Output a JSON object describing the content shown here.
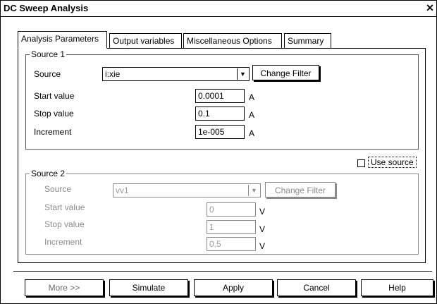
{
  "window": {
    "title": "DC Sweep Analysis",
    "close_glyph": "✕"
  },
  "tabs": [
    {
      "label": "Analysis Parameters",
      "active": true
    },
    {
      "label": "Output variables",
      "active": false
    },
    {
      "label": "Miscellaneous Options",
      "active": false
    },
    {
      "label": "Summary",
      "active": false
    }
  ],
  "source1": {
    "legend": "Source 1",
    "source_label": "Source",
    "source_value": "i:xie",
    "change_filter": "Change Filter",
    "start_label": "Start value",
    "start_value": "0.0001",
    "stop_label": "Stop value",
    "stop_value": "0.1",
    "increment_label": "Increment",
    "increment_value": "1e-005",
    "unit": "A"
  },
  "use_source": {
    "label": "Use source",
    "checked": false
  },
  "source2": {
    "legend": "Source 2",
    "source_label": "Source",
    "source_value": "vv1",
    "change_filter": "Change Filter",
    "start_label": "Start value",
    "start_value": "0",
    "stop_label": "Stop value",
    "stop_value": "1",
    "increment_label": "Increment",
    "increment_value": "0.5",
    "unit": "V",
    "disabled": true
  },
  "buttons": {
    "more": "More >>",
    "simulate": "Simulate",
    "apply": "Apply",
    "cancel": "Cancel",
    "help": "Help"
  },
  "icons": {
    "dropdown": "chevron-down-icon",
    "close": "close-icon",
    "checkbox": "checkbox-icon"
  }
}
